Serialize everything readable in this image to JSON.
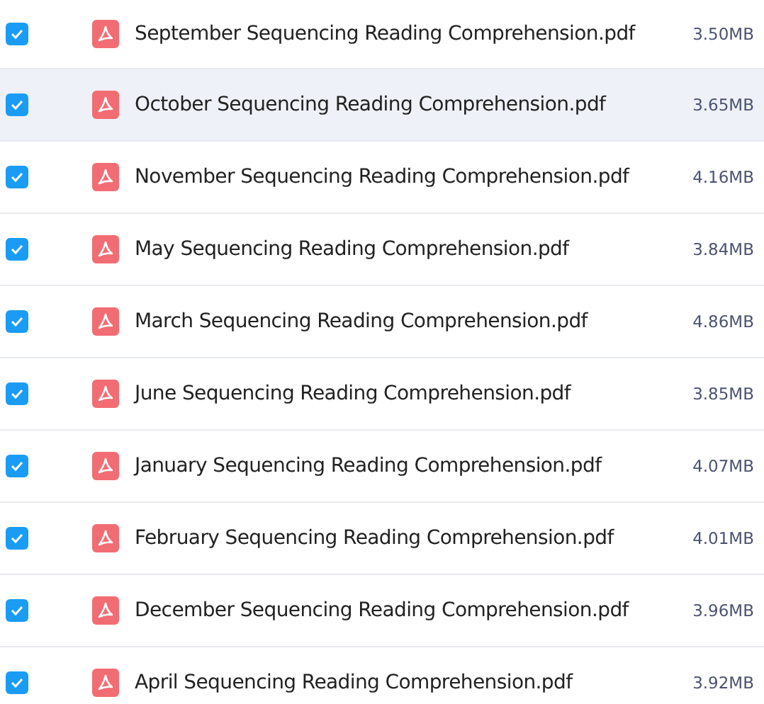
{
  "files": [
    {
      "name": "September Sequencing Reading Comprehension.pdf",
      "size": "3.50MB",
      "checked": true,
      "highlighted": false
    },
    {
      "name": "October Sequencing Reading Comprehension.pdf",
      "size": "3.65MB",
      "checked": true,
      "highlighted": true
    },
    {
      "name": "November Sequencing Reading Comprehension.pdf",
      "size": "4.16MB",
      "checked": true,
      "highlighted": false
    },
    {
      "name": "May Sequencing Reading Comprehension.pdf",
      "size": "3.84MB",
      "checked": true,
      "highlighted": false
    },
    {
      "name": "March Sequencing Reading Comprehension.pdf",
      "size": "4.86MB",
      "checked": true,
      "highlighted": false
    },
    {
      "name": "June Sequencing Reading Comprehension.pdf",
      "size": "3.85MB",
      "checked": true,
      "highlighted": false
    },
    {
      "name": "January Sequencing Reading Comprehension.pdf",
      "size": "4.07MB",
      "checked": true,
      "highlighted": false
    },
    {
      "name": "February Sequencing Reading Comprehension.pdf",
      "size": "4.01MB",
      "checked": true,
      "highlighted": false
    },
    {
      "name": "December Sequencing Reading Comprehension.pdf",
      "size": "3.96MB",
      "checked": true,
      "highlighted": false
    },
    {
      "name": "April Sequencing Reading Comprehension.pdf",
      "size": "3.92MB",
      "checked": true,
      "highlighted": false
    }
  ]
}
